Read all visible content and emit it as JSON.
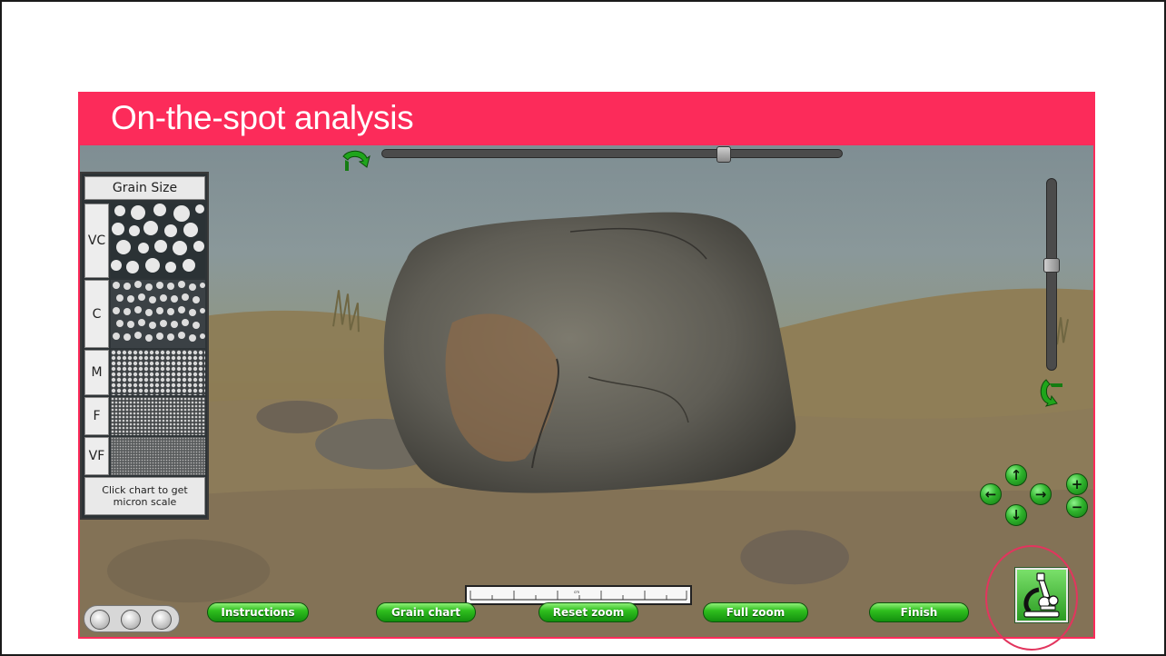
{
  "slide": {
    "title": "On-the-spot analysis",
    "accent_color": "#fc2b5a"
  },
  "grain_chart": {
    "title": "Grain Size",
    "rows": [
      {
        "label": "VC"
      },
      {
        "label": "C"
      },
      {
        "label": "M"
      },
      {
        "label": "F"
      },
      {
        "label": "VF"
      }
    ],
    "footer": "Click chart to get micron scale"
  },
  "sliders": {
    "rotation_horizontal": {
      "value": 0.75
    },
    "rotation_vertical": {
      "value": 0.45
    }
  },
  "nav_pad": {
    "up": "↑",
    "down": "↓",
    "left": "←",
    "right": "→",
    "zoom_in": "+",
    "zoom_out": "−",
    "icons": [
      "arrow-up-icon",
      "arrow-down-icon",
      "arrow-left-icon",
      "arrow-right-icon",
      "plus-icon",
      "minus-icon"
    ]
  },
  "toolbar": {
    "tools": [
      "speech-bubble-icon",
      "people-icon",
      "tools-icon"
    ],
    "buttons": {
      "instructions": "Instructions",
      "grain_chart": "Grain chart",
      "reset_zoom": "Reset zoom",
      "full_zoom": "Full zoom",
      "finish": "Finish"
    },
    "ruler_unit": "cm",
    "microscope_icon": "microscope-icon",
    "button_color": "#2fbf1e"
  }
}
